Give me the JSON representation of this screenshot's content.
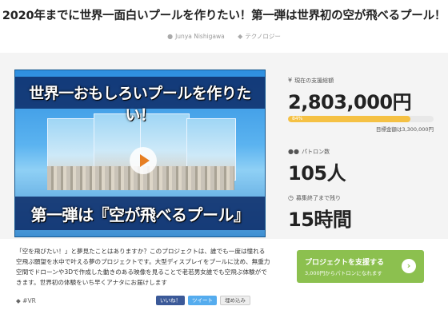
{
  "page": {
    "title": "2020年までに世界一面白いプールを作りたい！第一弾は世界初の空が飛べるプール！",
    "author": "Junya Nishigawa",
    "category": "テクノロジー"
  },
  "video": {
    "headline_top": "世界一おもしろいプールを作りたい！",
    "headline_bottom": "第一弾は『空が飛べるプール』"
  },
  "description": "「空を飛びたい！」と夢見たことはありますか？このプロジェクトは、誰でも一度は憧れる空飛ぶ願望を水中で叶える夢のプロジェクトです。大型ディスプレイをプールに沈め、無重力空間でドローンや3Dで作成した動きのある映像を見ることで老若男女誰でも空飛ぶ体験ができます。世界初の体験をいち早くアナタにお届けします",
  "tag": "#VR",
  "social": {
    "like": "いいね！",
    "tweet": "ツイート",
    "embed": "埋め込み"
  },
  "stats": {
    "raised_label": "現在の支援総額",
    "raised_value": "2,803,000円",
    "progress_percent": 84,
    "progress_label": "84%",
    "goal_text": "目標金額は3,300,000円",
    "backers_label": "パトロン数",
    "backers_value": "105人",
    "remaining_label": "募集終了まで残り",
    "remaining_value": "15時間"
  },
  "cta": {
    "label": "プロジェクトを支援する",
    "sublabel": "3,000円からパトロンになれます"
  },
  "colors": {
    "progress": "#f5c144",
    "cta": "#8cc04f"
  }
}
